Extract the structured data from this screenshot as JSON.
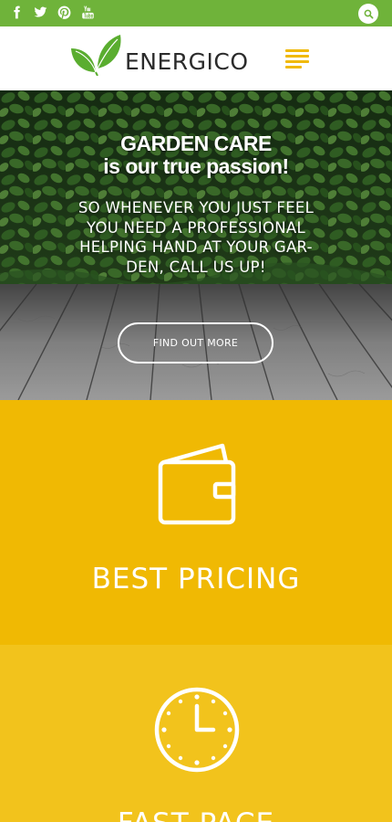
{
  "topbar": {
    "social": [
      {
        "icon": "facebook-icon"
      },
      {
        "icon": "twitter-icon"
      },
      {
        "icon": "pinterest-icon"
      },
      {
        "icon": "youtube-icon"
      }
    ],
    "search_icon": "search-icon"
  },
  "header": {
    "brand": "ENERGICO",
    "menu_icon": "hamburger-menu-icon"
  },
  "hero": {
    "title_line1": "GARDEN CARE",
    "title_line2": "is our true passion!",
    "text_lines": [
      "SO WHENEVER YOU JUST FEEL",
      "YOU NEED A PROFESSIONAL",
      "HELPING HAND AT YOUR GAR-",
      "DEN, CALL US UP!"
    ],
    "cta_label": "FIND OUT MORE"
  },
  "features": [
    {
      "icon": "wallet-icon",
      "title": "BEST PRICING"
    },
    {
      "icon": "clock-icon",
      "title": "FAST PACE"
    }
  ],
  "colors": {
    "topbar": "#6fb33a",
    "accent_yellow": "#f0b903",
    "accent_yellow_light": "#f2c31c",
    "menu": "#f0b90a"
  }
}
